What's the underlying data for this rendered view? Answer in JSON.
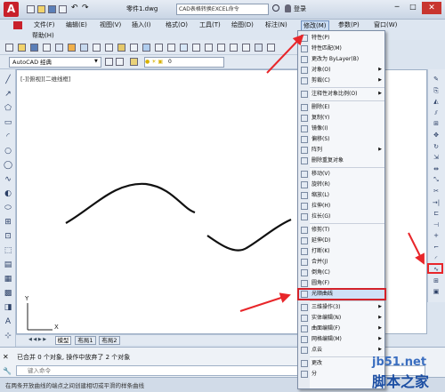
{
  "title": {
    "app": "A",
    "doc": "零件1.dwg",
    "search_placeholder": "CAD表格转换EXCEL命令",
    "sign_in": "登录"
  },
  "menubar": [
    "文件(F)",
    "编辑(E)",
    "视图(V)",
    "插入(I)",
    "格式(O)",
    "工具(T)",
    "绘图(D)",
    "标注(N)",
    "修改(M)",
    "参数(P)",
    "窗口(W)"
  ],
  "help": "帮助(H)",
  "workspace": "AutoCAD 经典",
  "layer_value": "0",
  "viewport_label": "[-][俯视][二维线框]",
  "tabs": [
    "模型",
    "布局1",
    "布局2"
  ],
  "axis": {
    "x": "X",
    "y": "Y"
  },
  "command_lines": [
    "已合并 0 个对象, 操作中放弃了 2 个对象"
  ],
  "command_placeholder": "键入命令",
  "status_text": "在两条开放曲线的端点之间创建相切或平滑的样条曲线",
  "dropdown": {
    "items": [
      {
        "label": "特性(P)",
        "arrow": false,
        "sep_before": false
      },
      {
        "label": "特性匹配(M)",
        "arrow": false,
        "sep_before": false
      },
      {
        "label": "更改为 ByLayer(B)",
        "arrow": false,
        "sep_before": false
      },
      {
        "label": "对象(O)",
        "arrow": true,
        "sep_before": false
      },
      {
        "label": "剪裁(C)",
        "arrow": true,
        "sep_before": false
      },
      {
        "label": "注释性对象比例(O)",
        "arrow": true,
        "sep_before": true
      },
      {
        "label": "删除(E)",
        "arrow": false,
        "sep_before": true
      },
      {
        "label": "复制(Y)",
        "arrow": false,
        "sep_before": false
      },
      {
        "label": "镜像(I)",
        "arrow": false,
        "sep_before": false
      },
      {
        "label": "偏移(S)",
        "arrow": false,
        "sep_before": false
      },
      {
        "label": "阵列",
        "arrow": true,
        "sep_before": false
      },
      {
        "label": "删除重复对象",
        "arrow": false,
        "sep_before": false
      },
      {
        "label": "移动(V)",
        "arrow": false,
        "sep_before": true
      },
      {
        "label": "旋转(R)",
        "arrow": false,
        "sep_before": false
      },
      {
        "label": "缩放(L)",
        "arrow": false,
        "sep_before": false
      },
      {
        "label": "拉伸(H)",
        "arrow": false,
        "sep_before": false
      },
      {
        "label": "拉长(G)",
        "arrow": false,
        "sep_before": false
      },
      {
        "label": "修剪(T)",
        "arrow": false,
        "sep_before": true
      },
      {
        "label": "延伸(D)",
        "arrow": false,
        "sep_before": false
      },
      {
        "label": "打断(K)",
        "arrow": false,
        "sep_before": false
      },
      {
        "label": "合并(J)",
        "arrow": false,
        "sep_before": false
      },
      {
        "label": "倒角(C)",
        "arrow": false,
        "sep_before": false
      },
      {
        "label": "圆角(F)",
        "arrow": false,
        "sep_before": false
      },
      {
        "label": "光顺曲线",
        "arrow": false,
        "sep_before": false,
        "selected": true
      },
      {
        "label": "三维操作(3)",
        "arrow": true,
        "sep_before": true
      },
      {
        "label": "实体编辑(N)",
        "arrow": true,
        "sep_before": false
      },
      {
        "label": "曲面编辑(F)",
        "arrow": true,
        "sep_before": false
      },
      {
        "label": "网格编辑(M)",
        "arrow": true,
        "sep_before": false
      },
      {
        "label": "点云",
        "arrow": true,
        "sep_before": false
      },
      {
        "label": "更改",
        "arrow": false,
        "sep_before": true
      },
      {
        "label": "分",
        "arrow": false,
        "sep_before": false
      }
    ]
  },
  "watermark": {
    "site": "jb51.net",
    "name": "脚本之家"
  },
  "colors": {
    "accent": "#c8202a",
    "highlight": "#2c5fb0",
    "arrow": "#e8262a"
  }
}
